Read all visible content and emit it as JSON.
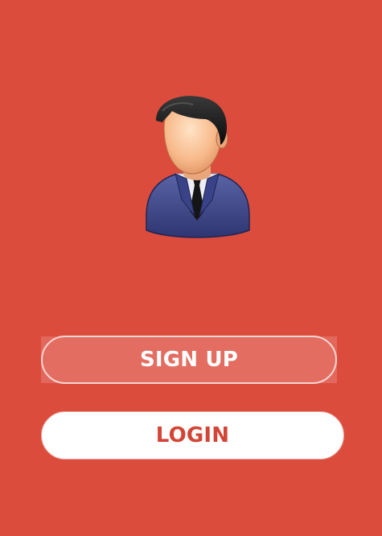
{
  "screen": {
    "avatar_icon": "businessman-avatar-icon"
  },
  "actions": {
    "signup_label": "SIGN UP",
    "login_label": "LOGIN"
  },
  "colors": {
    "background": "#DC4C3D",
    "signup_fill": "#E46D62",
    "signup_border": "#F6D5D1",
    "login_fill": "#FFFFFF",
    "login_text": "#D34536"
  }
}
